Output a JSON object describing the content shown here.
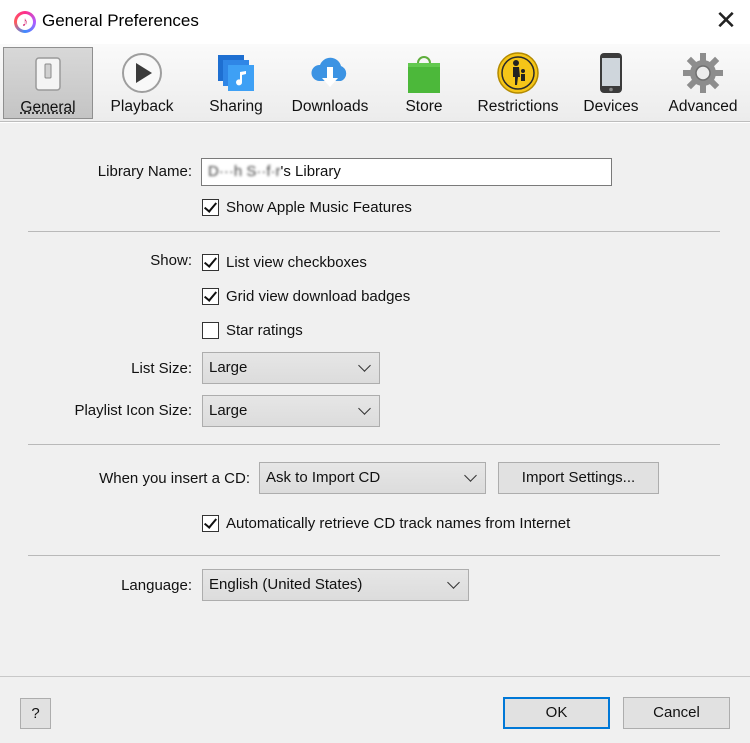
{
  "window": {
    "title": "General Preferences",
    "close_glyph": "✕"
  },
  "toolbar": {
    "items": [
      {
        "label": "General",
        "icon": "general-switch-icon",
        "active": true
      },
      {
        "label": "Playback",
        "icon": "play-icon"
      },
      {
        "label": "Sharing",
        "icon": "sharing-icon"
      },
      {
        "label": "Downloads",
        "icon": "cloud-download-icon"
      },
      {
        "label": "Store",
        "icon": "shopping-bag-icon"
      },
      {
        "label": "Restrictions",
        "icon": "parental-restrictions-icon"
      },
      {
        "label": "Devices",
        "icon": "phone-icon"
      },
      {
        "label": "Advanced",
        "icon": "gear-icon"
      }
    ]
  },
  "library": {
    "label": "Library Name:",
    "value_obscured": "D···h S··f·r",
    "value_suffix": "'s Library",
    "apple_music": {
      "label": "Show Apple Music Features",
      "checked": true
    }
  },
  "show": {
    "label": "Show:",
    "options": [
      {
        "label": "List view checkboxes",
        "checked": true
      },
      {
        "label": "Grid view download badges",
        "checked": true
      },
      {
        "label": "Star ratings",
        "checked": false
      }
    ]
  },
  "list_size": {
    "label": "List Size:",
    "value": "Large"
  },
  "playlist_icon_size": {
    "label": "Playlist Icon Size:",
    "value": "Large"
  },
  "cd": {
    "label": "When you insert a CD:",
    "value": "Ask to Import CD",
    "import_settings_label": "Import Settings...",
    "auto_retrieve": {
      "label": "Automatically retrieve CD track names from Internet",
      "checked": true
    }
  },
  "language": {
    "label": "Language:",
    "value": "English (United States)"
  },
  "footer": {
    "help_label": "?",
    "ok_label": "OK",
    "cancel_label": "Cancel"
  },
  "colors": {
    "accent": "#0078d7",
    "panel": "#f0f0f0",
    "toolbar": "#ececec"
  }
}
